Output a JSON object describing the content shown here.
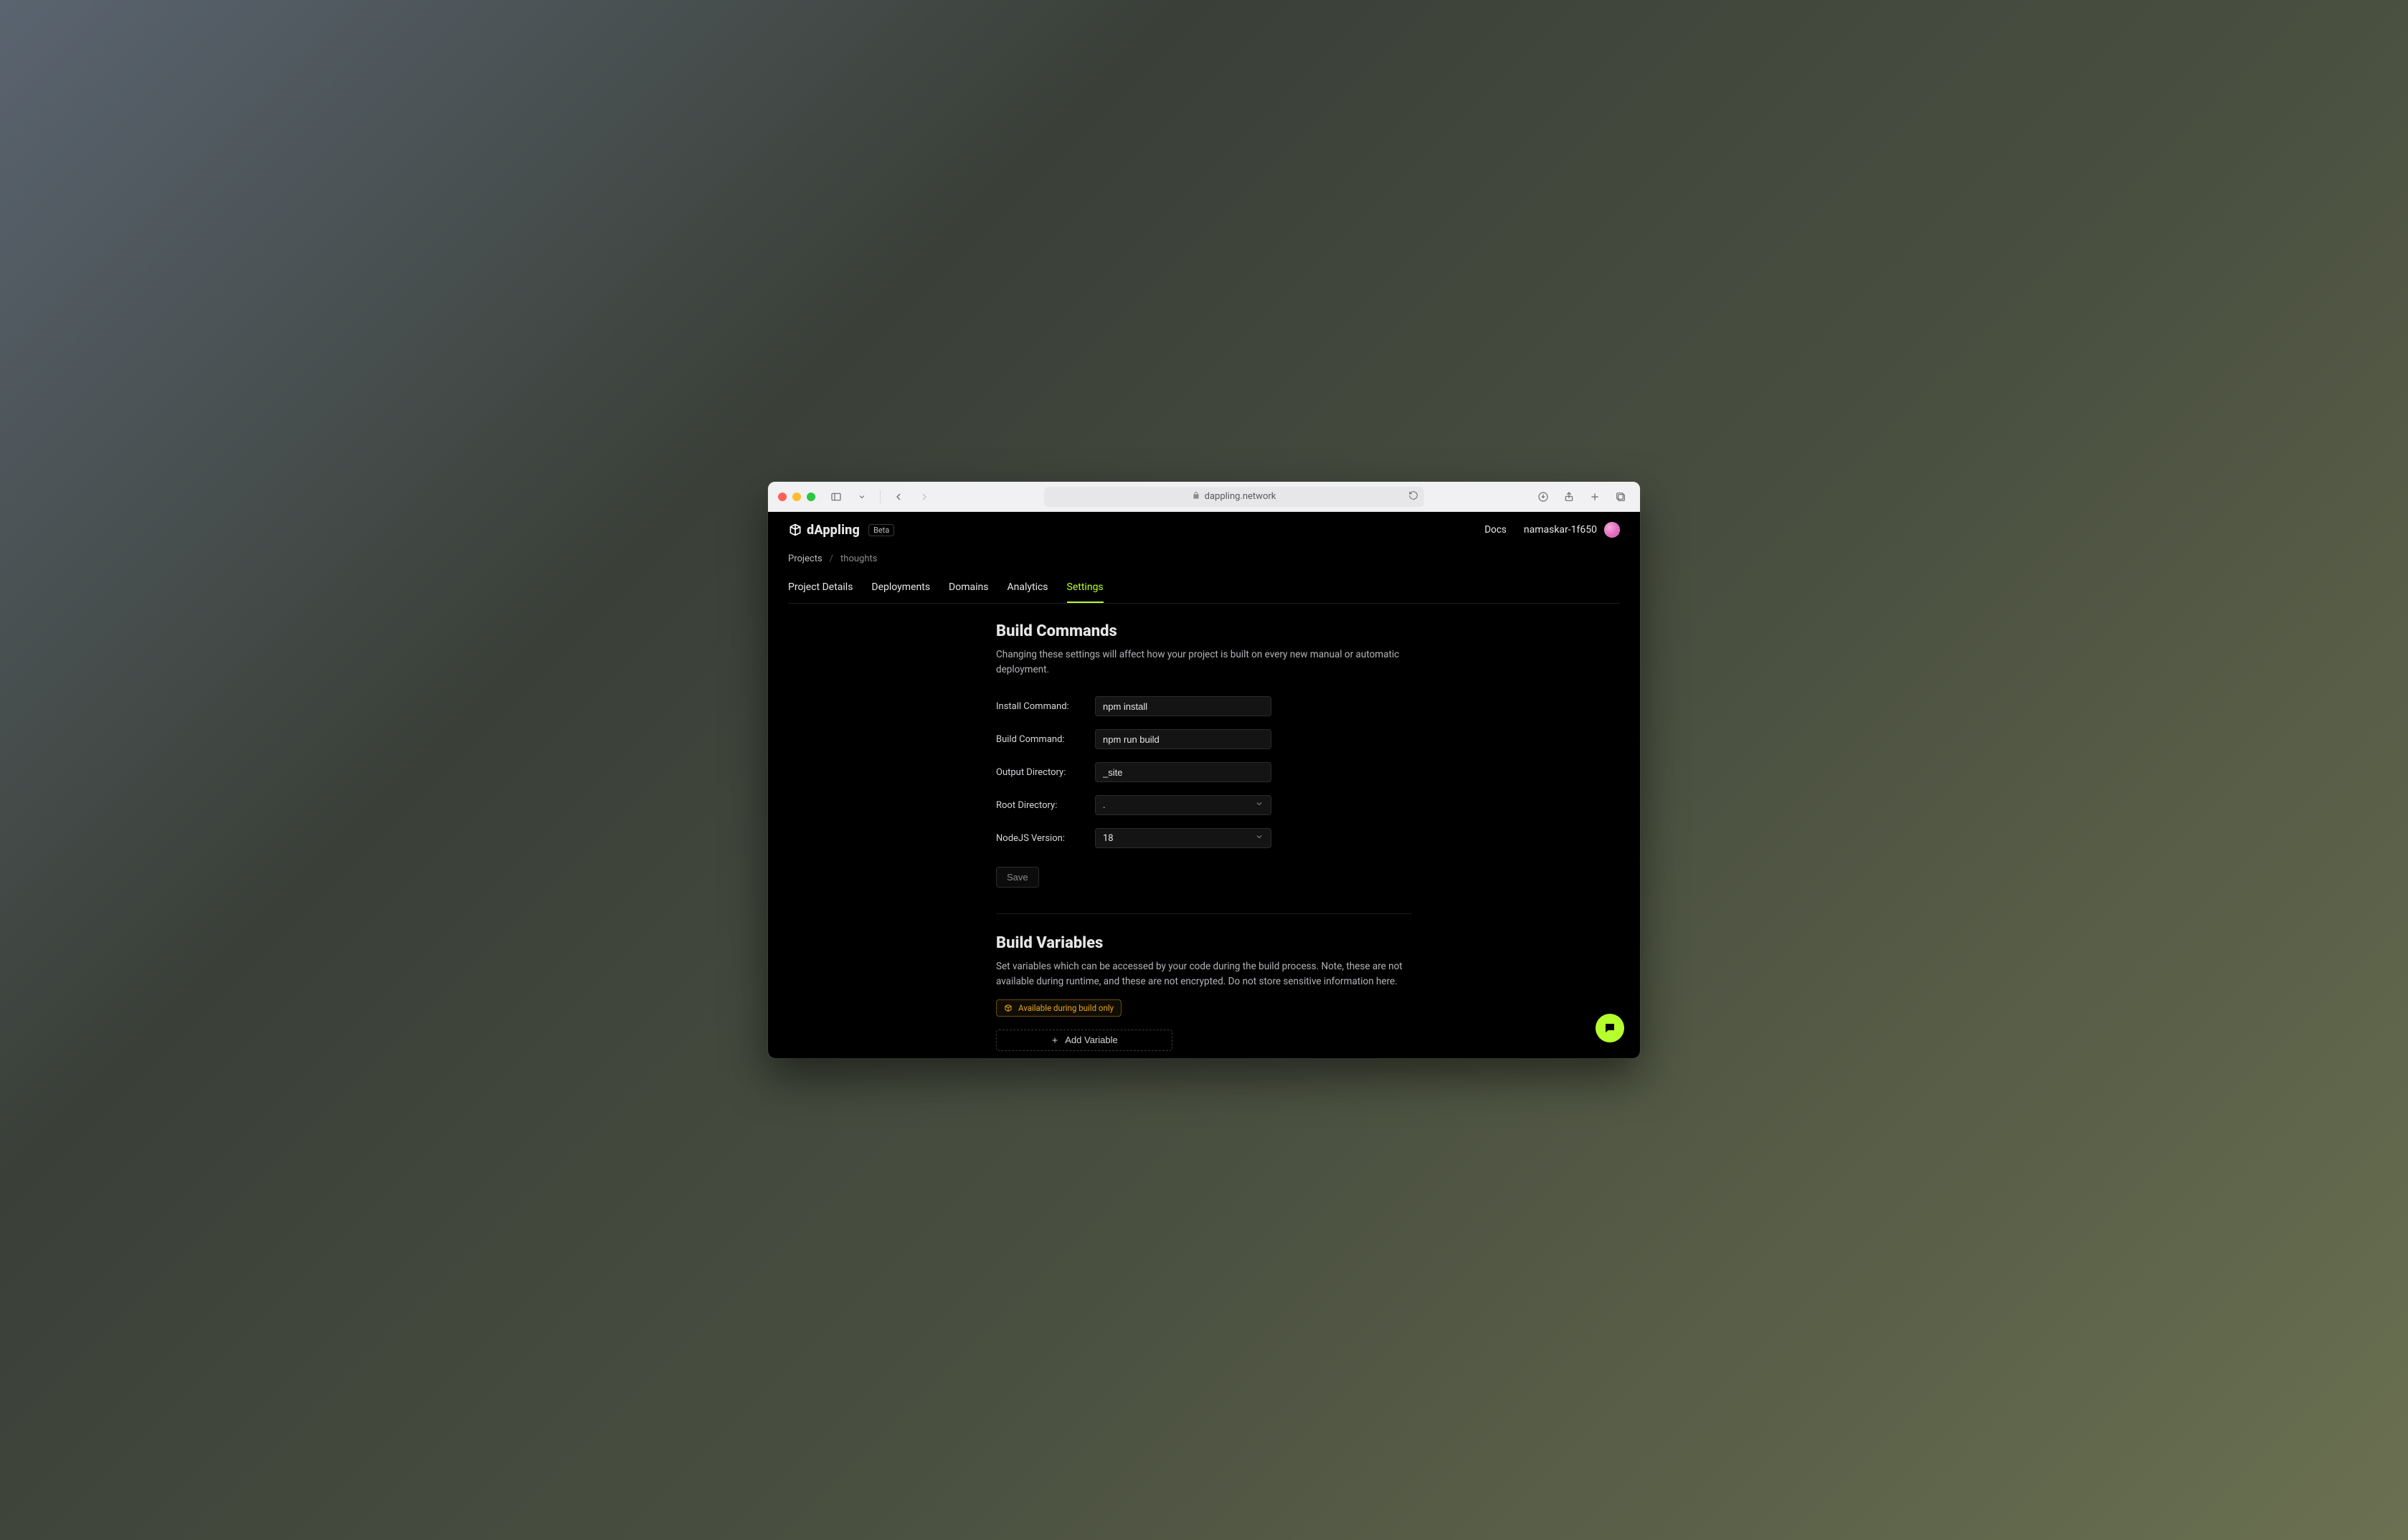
{
  "browser": {
    "url_host": "dappling.network"
  },
  "header": {
    "brand": "dAppling",
    "badge": "Beta",
    "docs_label": "Docs",
    "username": "namaskar-1f650"
  },
  "breadcrumbs": {
    "root": "Projects",
    "current": "thoughts"
  },
  "tabs": {
    "items": [
      {
        "label": "Project Details"
      },
      {
        "label": "Deployments"
      },
      {
        "label": "Domains"
      },
      {
        "label": "Analytics"
      },
      {
        "label": "Settings"
      }
    ],
    "active_index": 4
  },
  "build_commands": {
    "title": "Build Commands",
    "description": "Changing these settings will affect how your project is built on every new manual or automatic deployment.",
    "fields": {
      "install": {
        "label": "Install Command:",
        "value": "npm install"
      },
      "build": {
        "label": "Build Command:",
        "value": "npm run build"
      },
      "output": {
        "label": "Output Directory:",
        "value": "_site"
      },
      "root": {
        "label": "Root Directory:",
        "value": "."
      },
      "node": {
        "label": "NodeJS Version:",
        "value": "18"
      }
    },
    "save_label": "Save"
  },
  "build_variables": {
    "title": "Build Variables",
    "description": "Set variables which can be accessed by your code during the build process. Note, these are not available during runtime, and these are not encrypted. Do not store sensitive information here.",
    "pill_label": "Available during build only",
    "add_label": "Add Variable"
  }
}
